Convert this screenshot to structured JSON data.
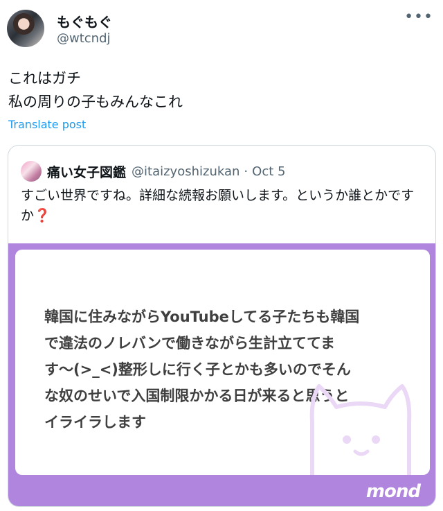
{
  "author": {
    "display_name": "もぐもぐ",
    "handle": "@wtcndj"
  },
  "post": {
    "lines": [
      "これはガチ",
      "私の周りの子もみんなこれ"
    ],
    "translate_label": "Translate post"
  },
  "quote": {
    "display_name": "痛い女子図鑑",
    "handle": "@itaizyoshizukan",
    "separator": "·",
    "date": "Oct 5",
    "text": "すごい世界ですね。詳細な続報お願いします。というか誰とかですか",
    "emoji": "❓",
    "media": {
      "lines": [
        "韓国に住みながらYouTubeしてる子たちも韓国",
        "で違法のノレバンで働きながら生計立ててま",
        "す〜(>_<)整形しに行く子とかも多いのでそん",
        "な奴のせいで入国制限かかる日が来ると思うと",
        "イライラします"
      ],
      "brand": "mond",
      "frame_color": "#b085de"
    }
  },
  "icons": {
    "more": "more-horizontal-icon"
  },
  "colors": {
    "link": "#1d9bf0",
    "secondary_text": "#536471",
    "border": "#cfd9de"
  }
}
